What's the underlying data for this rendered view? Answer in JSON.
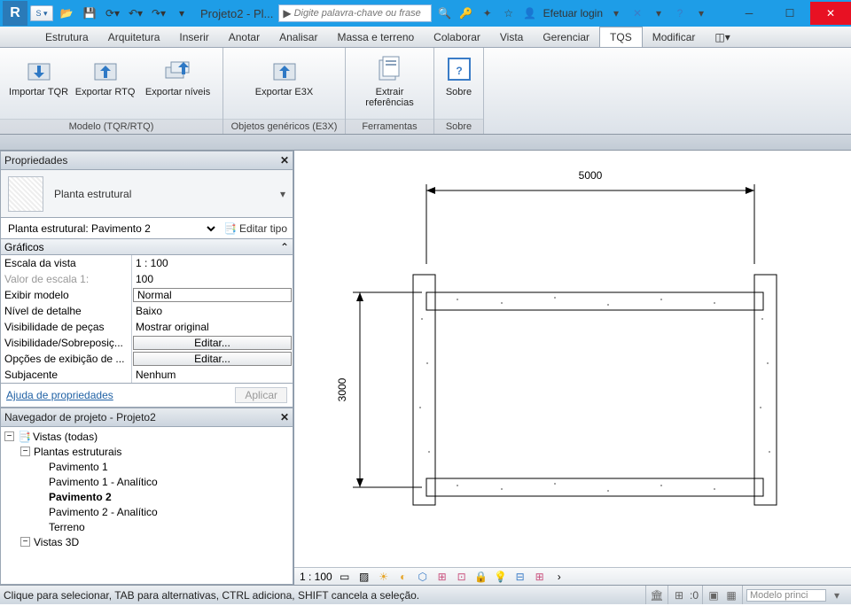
{
  "window": {
    "title": "Projeto2 - Pl...",
    "search_placeholder": "Digite palavra-chave ou frase",
    "login_label": "Efetuar login"
  },
  "menu": {
    "items": [
      "Estrutura",
      "Arquitetura",
      "Inserir",
      "Anotar",
      "Analisar",
      "Massa e terreno",
      "Colaborar",
      "Vista",
      "Gerenciar",
      "TQS",
      "Modificar"
    ],
    "active": "TQS"
  },
  "ribbon": {
    "groups": [
      {
        "title": "Modelo (TQR/RTQ)",
        "buttons": [
          "Importar TQR",
          "Exportar RTQ",
          "Exportar níveis"
        ]
      },
      {
        "title": "Objetos genéricos (E3X)",
        "buttons": [
          "Exportar E3X"
        ]
      },
      {
        "title": "Ferramentas",
        "buttons": [
          "Extrair referências"
        ]
      },
      {
        "title": "Sobre",
        "buttons": [
          "Sobre"
        ]
      }
    ]
  },
  "properties": {
    "panel_title": "Propriedades",
    "type_label": "Planta estrutural",
    "instance_label": "Planta estrutural: Pavimento 2",
    "edit_type_label": "Editar tipo",
    "group": "Gráficos",
    "rows": [
      {
        "name": "Escala da vista",
        "value": "1 : 100"
      },
      {
        "name": "Valor de escala    1:",
        "value": "100",
        "dim": true
      },
      {
        "name": "Exibir modelo",
        "value": "Normal",
        "boxed": true
      },
      {
        "name": "Nível de detalhe",
        "value": "Baixo"
      },
      {
        "name": "Visibilidade de peças",
        "value": "Mostrar original"
      },
      {
        "name": "Visibilidade/Sobreposiç...",
        "value": "Editar...",
        "btn": true
      },
      {
        "name": "Opções de exibição de ...",
        "value": "Editar...",
        "btn": true
      },
      {
        "name": "Subjacente",
        "value": "Nenhum"
      }
    ],
    "help_link": "Ajuda de propriedades",
    "apply_label": "Aplicar"
  },
  "browser": {
    "panel_title": "Navegador de projeto - Projeto2",
    "root": "Vistas (todas)",
    "group1": "Plantas estruturais",
    "items1": [
      "Pavimento 1",
      "Pavimento 1 - Analítico",
      "Pavimento 2",
      "Pavimento 2 - Analítico",
      "Terreno"
    ],
    "active_item": "Pavimento 2",
    "group2": "Vistas 3D"
  },
  "drawing": {
    "dim_horizontal": "5000",
    "dim_vertical": "3000"
  },
  "view_status": {
    "scale": "1 : 100"
  },
  "statusbar": {
    "message": "Clique para selecionar, TAB para alternativas, CTRL adiciona, SHIFT cancela a seleção.",
    "coord": ":0",
    "filter": "Modelo princi"
  }
}
